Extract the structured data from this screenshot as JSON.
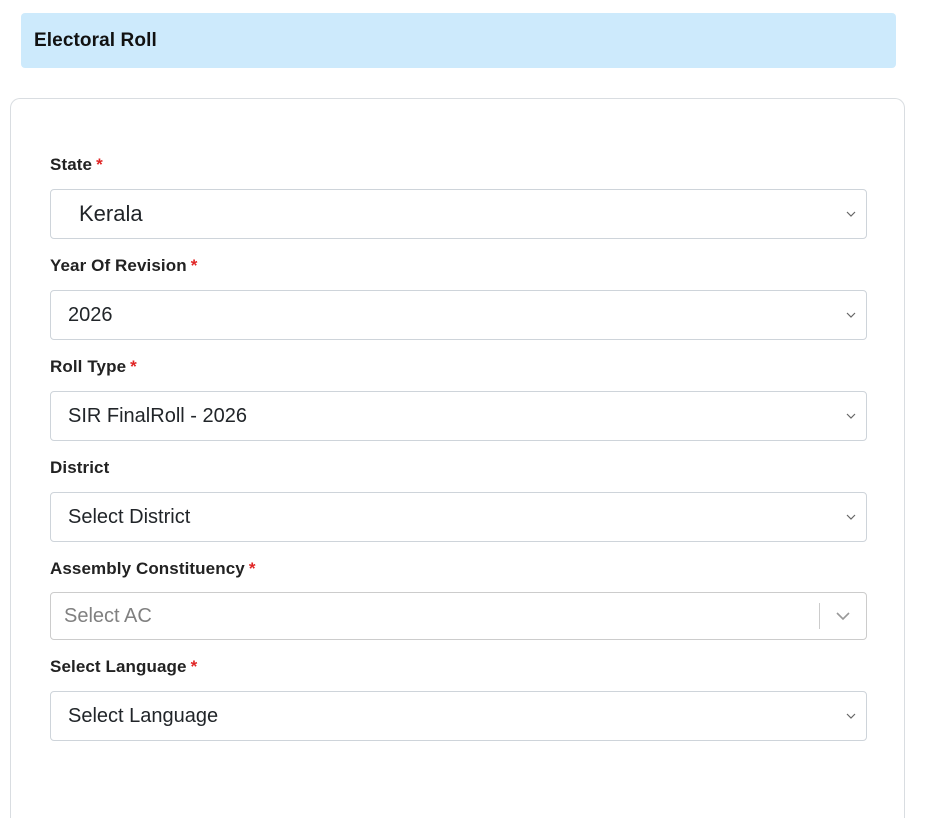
{
  "header": {
    "title": "Electoral Roll"
  },
  "form": {
    "state": {
      "label": "State",
      "required_mark": "*",
      "value": "Kerala"
    },
    "year_of_revision": {
      "label": "Year Of Revision",
      "required_mark": "*",
      "value": "2026"
    },
    "roll_type": {
      "label": "Roll Type",
      "required_mark": "*",
      "value": "SIR FinalRoll - 2026"
    },
    "district": {
      "label": "District",
      "value": "Select District"
    },
    "assembly_constituency": {
      "label": "Assembly Constituency",
      "required_mark": "*",
      "placeholder": "Select AC"
    },
    "language": {
      "label": "Select Language",
      "required_mark": "*",
      "value": "Select Language"
    }
  },
  "icons": {
    "select_arrow": "chevron-down-icon"
  },
  "colors": {
    "header_bg": "#cdeafc",
    "required": "#e02424",
    "border": "#ced4da"
  }
}
